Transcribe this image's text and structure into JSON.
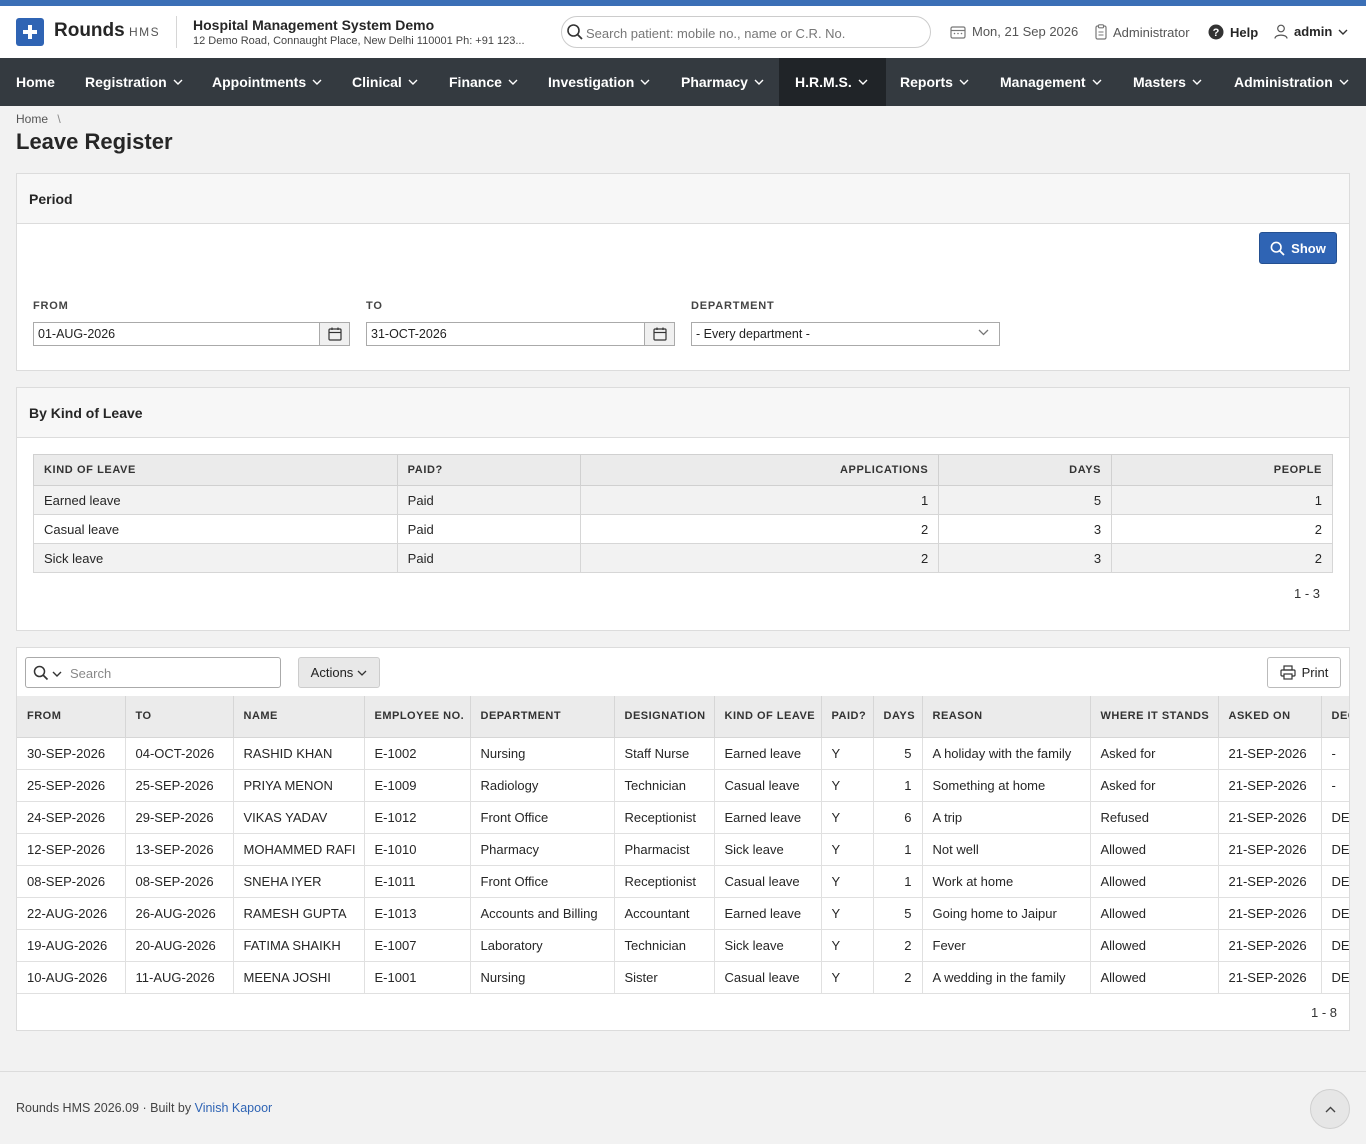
{
  "header": {
    "brand": "Rounds",
    "brand_sub": "HMS",
    "hospital_name": "Hospital Management System Demo",
    "hospital_address": "12 Demo Road, Connaught Place, New Delhi 110001 Ph: +91 123...",
    "search_placeholder": "Search patient: mobile no., name or C.R. No.",
    "date": "Mon, 21 Sep 2026",
    "role": "Administrator",
    "help": "Help",
    "user": "admin"
  },
  "nav": {
    "home": "Home",
    "registration": "Registration",
    "appointments": "Appointments",
    "clinical": "Clinical",
    "finance": "Finance",
    "investigation": "Investigation",
    "pharmacy": "Pharmacy",
    "hrms": "H.R.M.S.",
    "reports": "Reports",
    "management": "Management",
    "masters": "Masters",
    "administration": "Administration"
  },
  "breadcrumb": {
    "home": "Home",
    "sep": "\\"
  },
  "page_title": "Leave Register",
  "period": {
    "title": "Period",
    "show_button": "Show",
    "from_label": "FROM",
    "from_value": "01-AUG-2026",
    "to_label": "TO",
    "to_value": "31-OCT-2026",
    "department_label": "DEPARTMENT",
    "department_value": "- Every department -"
  },
  "by_kind": {
    "title": "By Kind of Leave",
    "headers": [
      "KIND OF LEAVE",
      "PAID?",
      "APPLICATIONS",
      "DAYS",
      "PEOPLE"
    ],
    "rows": [
      [
        "Earned leave",
        "Paid",
        "1",
        "5",
        "1"
      ],
      [
        "Casual leave",
        "Paid",
        "2",
        "3",
        "2"
      ],
      [
        "Sick leave",
        "Paid",
        "2",
        "3",
        "2"
      ]
    ],
    "pager": "1 - 3"
  },
  "register": {
    "search_placeholder": "Search",
    "actions_label": "Actions",
    "print_label": "Print",
    "headers": [
      "FROM",
      "TO",
      "NAME",
      "EMPLOYEE NO.",
      "DEPARTMENT",
      "DESIGNATION",
      "KIND OF LEAVE",
      "PAID?",
      "DAYS",
      "REASON",
      "WHERE IT STANDS",
      "ASKED ON",
      "DECIDED BY"
    ],
    "rows": [
      [
        "30-SEP-2026",
        "04-OCT-2026",
        "RASHID KHAN",
        "E-1002",
        "Nursing",
        "Staff Nurse",
        "Earned leave",
        "Y",
        "5",
        "A holiday with the family",
        "Asked for",
        "21-SEP-2026",
        "-"
      ],
      [
        "25-SEP-2026",
        "25-SEP-2026",
        "PRIYA MENON",
        "E-1009",
        "Radiology",
        "Technician",
        "Casual leave",
        "Y",
        "1",
        "Something at home",
        "Asked for",
        "21-SEP-2026",
        "-"
      ],
      [
        "24-SEP-2026",
        "29-SEP-2026",
        "VIKAS YADAV",
        "E-1012",
        "Front Office",
        "Receptionist",
        "Earned leave",
        "Y",
        "6",
        "A trip",
        "Refused",
        "21-SEP-2026",
        "DE"
      ],
      [
        "12-SEP-2026",
        "13-SEP-2026",
        "MOHAMMED RAFI",
        "E-1010",
        "Pharmacy",
        "Pharmacist",
        "Sick leave",
        "Y",
        "1",
        "Not well",
        "Allowed",
        "21-SEP-2026",
        "DE"
      ],
      [
        "08-SEP-2026",
        "08-SEP-2026",
        "SNEHA IYER",
        "E-1011",
        "Front Office",
        "Receptionist",
        "Casual leave",
        "Y",
        "1",
        "Work at home",
        "Allowed",
        "21-SEP-2026",
        "DE"
      ],
      [
        "22-AUG-2026",
        "26-AUG-2026",
        "RAMESH GUPTA",
        "E-1013",
        "Accounts and Billing",
        "Accountant",
        "Earned leave",
        "Y",
        "5",
        "Going home to Jaipur",
        "Allowed",
        "21-SEP-2026",
        "DE"
      ],
      [
        "19-AUG-2026",
        "20-AUG-2026",
        "FATIMA SHAIKH",
        "E-1007",
        "Laboratory",
        "Technician",
        "Sick leave",
        "Y",
        "2",
        "Fever",
        "Allowed",
        "21-SEP-2026",
        "DE"
      ],
      [
        "10-AUG-2026",
        "11-AUG-2026",
        "MEENA JOSHI",
        "E-1001",
        "Nursing",
        "Sister",
        "Casual leave",
        "Y",
        "2",
        "A wedding in the family",
        "Allowed",
        "21-SEP-2026",
        "DE"
      ]
    ],
    "pager": "1 - 8"
  },
  "footer": {
    "text": "Rounds HMS 2026.09 · Built by",
    "author": "Vinish Kapoor"
  },
  "colors": {
    "accent": "#2f64b4",
    "navbar": "#343a40",
    "navbar_active": "#202428"
  }
}
